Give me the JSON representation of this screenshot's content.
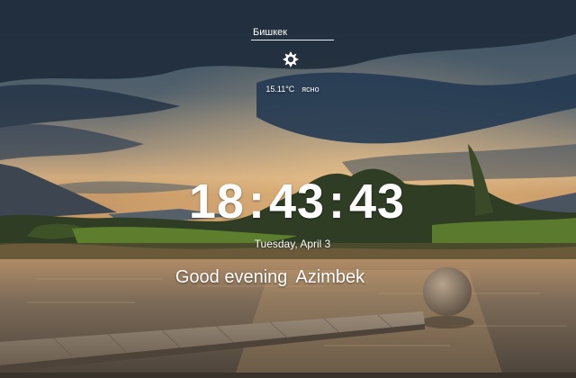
{
  "weather": {
    "city": "Бишкек",
    "icon": "sun-icon",
    "temperature": "15.11°C",
    "description": "ясно"
  },
  "clock": {
    "hours": "18",
    "minutes": "43",
    "seconds": "43",
    "separator": ":"
  },
  "date": "Tuesday, April 3",
  "greeting": {
    "text": "Good evening",
    "name": "Azimbek"
  },
  "colors": {
    "text": "#ffffff",
    "sky_dark": "#1f2e3f",
    "sunset": "#d8a56a",
    "water": "#7a6a5a",
    "grass": "#5a7a2e"
  }
}
